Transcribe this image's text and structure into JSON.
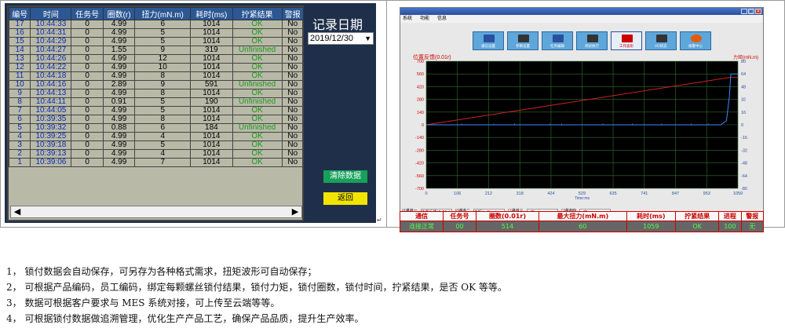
{
  "left": {
    "columns": [
      "编号",
      "时间",
      "任务号",
      "圈数(r)",
      "扭力(mN.m)",
      "耗时(ms)",
      "拧紧结果",
      "警报"
    ],
    "rows": [
      [
        "17",
        "10:44:33",
        "0",
        "4.99",
        "6",
        "1014",
        "OK",
        "No"
      ],
      [
        "16",
        "10:44:31",
        "0",
        "4.99",
        "5",
        "1014",
        "OK",
        "No"
      ],
      [
        "15",
        "10:44:29",
        "0",
        "4.99",
        "5",
        "1014",
        "OK",
        "No"
      ],
      [
        "14",
        "10:44:27",
        "0",
        "1.55",
        "9",
        "319",
        "Unfinished",
        "No"
      ],
      [
        "13",
        "10:44:26",
        "0",
        "4.99",
        "12",
        "1014",
        "OK",
        "No"
      ],
      [
        "12",
        "10:44:22",
        "0",
        "4.99",
        "10",
        "1014",
        "OK",
        "No"
      ],
      [
        "11",
        "10:44:18",
        "0",
        "4.99",
        "8",
        "1014",
        "OK",
        "No"
      ],
      [
        "10",
        "10:44:16",
        "0",
        "2.89",
        "9",
        "591",
        "Unfinished",
        "No"
      ],
      [
        "9",
        "10:44:13",
        "0",
        "4.99",
        "8",
        "1014",
        "OK",
        "No"
      ],
      [
        "8",
        "10:44:11",
        "0",
        "0.91",
        "5",
        "190",
        "Unfinished",
        "No"
      ],
      [
        "7",
        "10:44:05",
        "0",
        "4.99",
        "5",
        "1014",
        "OK",
        "No"
      ],
      [
        "6",
        "10:39:35",
        "0",
        "4.99",
        "8",
        "1014",
        "OK",
        "No"
      ],
      [
        "5",
        "10:39:32",
        "0",
        "0.88",
        "6",
        "184",
        "Unfinished",
        "No"
      ],
      [
        "4",
        "10:39:25",
        "0",
        "4.99",
        "4",
        "1014",
        "OK",
        "No"
      ],
      [
        "3",
        "10:39:18",
        "0",
        "4.99",
        "5",
        "1014",
        "OK",
        "No"
      ],
      [
        "2",
        "10:39:13",
        "0",
        "4.99",
        "4",
        "1014",
        "OK",
        "No"
      ],
      [
        "1",
        "10:39:06",
        "0",
        "4.99",
        "7",
        "1014",
        "OK",
        "No"
      ]
    ],
    "record_title": "记录日期",
    "date_value": "2019/12/30",
    "clear_label": "清除数据",
    "back_label": "返回",
    "scroll_left": "◀",
    "scroll_right": "▶",
    "date_arrow": "▼",
    "side_mark": "↵"
  },
  "right": {
    "menu": [
      "系统",
      "功能",
      "信息"
    ],
    "window_buttons": [
      "_",
      "□",
      "×"
    ],
    "tabs": [
      {
        "label": "通信设置",
        "icon": "monitor-icon"
      },
      {
        "label": "参数设置",
        "icon": "gear-icon"
      },
      {
        "label": "任务编辑",
        "icon": "document-icon"
      },
      {
        "label": "调试执行",
        "icon": "screwdriver-icon"
      },
      {
        "label": "工作波形",
        "icon": "waveform-icon",
        "active": true
      },
      {
        "label": "I/O状态",
        "icon": "io-icon"
      },
      {
        "label": "报警中心",
        "icon": "alarm-icon"
      }
    ],
    "left_axis_label": "位置反馈(0.01r)",
    "right_axis_label": "力矩(mN.m)",
    "x_axis_label": "Time:ms",
    "legend": {
      "ch1_label": "通道一",
      "ch1_value": "位置反馈(0.01r)",
      "ch2_label": "通道二",
      "ch2_value": "力矩(mN.m)",
      "ch3_label": "通道三",
      "ch3_value": "<空>",
      "ch4_label": "通道四",
      "ch4_value": "<空>"
    }
  },
  "chart_data": {
    "type": "line",
    "x": [
      0,
      106,
      212,
      318,
      424,
      529,
      635,
      741,
      847,
      953,
      1059
    ],
    "xticks": [
      "0",
      "106",
      "212",
      "318",
      "424",
      "529",
      "635",
      "741",
      "847",
      "953",
      "1059"
    ],
    "yticks_left": [
      700,
      560,
      420,
      280,
      140,
      0,
      -140,
      -280,
      -420,
      -560,
      -700
    ],
    "yticks_right": [
      80,
      64,
      48,
      32,
      16,
      0,
      -16,
      -32,
      -48,
      -64,
      -80
    ],
    "xlim": [
      0,
      1059
    ],
    "ylim_left": [
      -700,
      700
    ],
    "ylim_right": [
      -80,
      80
    ],
    "xlabel": "Time:ms",
    "ylabel_left": "位置反馈(0.01r)",
    "ylabel_right": "力矩(mN.m)",
    "grid": true,
    "series": [
      {
        "name": "位置反馈(0.01r)",
        "color": "#d22020",
        "axis": "left",
        "points": [
          [
            0,
            0
          ],
          [
            1030,
            520
          ],
          [
            1059,
            520
          ]
        ]
      },
      {
        "name": "力矩(mN.m)",
        "color": "#3a8bff",
        "axis": "right",
        "points": [
          [
            0,
            0
          ],
          [
            1000,
            0
          ],
          [
            1020,
            5
          ],
          [
            1030,
            35
          ],
          [
            1035,
            64
          ],
          [
            1059,
            64
          ]
        ]
      }
    ]
  },
  "status": {
    "headers": [
      "通信",
      "任务号",
      "圈数(0.01r)",
      "最大扭力(mN.m)",
      "耗时(ms)",
      "拧紧结果",
      "进程",
      "警报"
    ],
    "values": [
      "连接正常",
      "00",
      "514",
      "60",
      "1059",
      "OK",
      "100",
      "无"
    ]
  },
  "notes": [
    "1， 锁付数据会自动保存，可另存为各种格式需求，扭矩波形可自动保存；",
    "2， 可根据产品编码，员工编码，绑定每颗螺丝锁付结果，锁付力矩，锁付圈数，锁付时间，拧紧结果，是否 OK 等等。",
    "3， 数据可根据客户要求与 MES 系统对接，可上传至云端等等。",
    "4， 可根据锁付数据做追溯管理，优化生产产品工艺，确保产品品质，提升生产效率。"
  ],
  "colors": {
    "panel_bg": "#1f2f4a",
    "header_bg": "#2b5794",
    "ok_green": "#1a9b1a",
    "clear_btn": "#16a05a",
    "back_btn": "#f2e400",
    "status_text": "#4cff4c"
  }
}
